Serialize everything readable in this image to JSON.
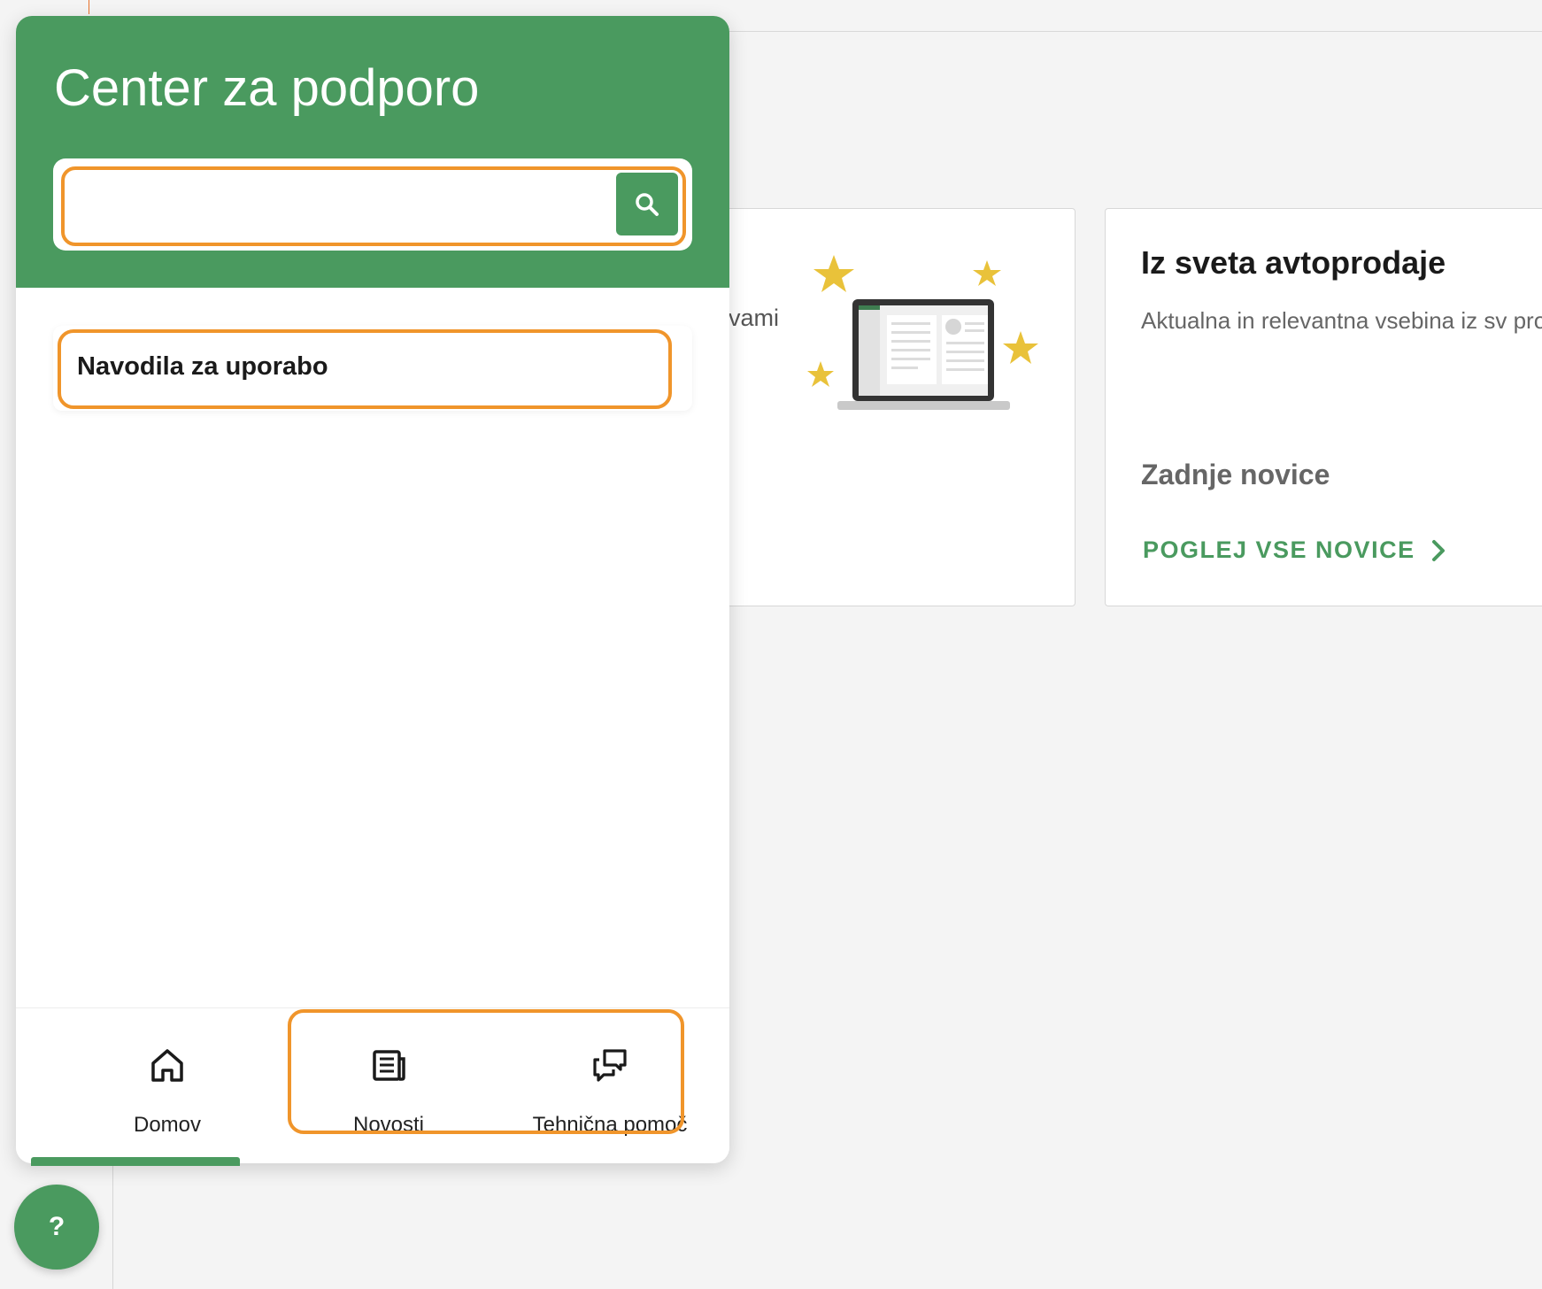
{
  "widget": {
    "title": "Center za podporo",
    "search": {
      "placeholder": "",
      "value": ""
    },
    "guide_item": {
      "label": "Navodila za uporabo"
    },
    "nav": [
      {
        "label": "Domov",
        "icon": "home-icon",
        "active": true
      },
      {
        "label": "Novosti",
        "icon": "newspaper-icon",
        "active": false
      },
      {
        "label": "Tehnična pomoč",
        "icon": "chat-bubbles-icon",
        "active": false
      }
    ],
    "help_button": "?"
  },
  "background": {
    "card_1": {
      "text": "vami"
    },
    "card_2": {
      "title": "Iz sveta avtoprodaje",
      "description": "Aktualna in relevantna vsebina iz sv prodaje.",
      "subtitle": "Zadnje novice",
      "link_label": "POGLEJ VSE NOVICE"
    }
  },
  "colors": {
    "brand_green": "#4a9a5f",
    "highlight_orange": "#f0952b",
    "star_yellow": "#e9c23a",
    "page_background": "#f4f4f4"
  }
}
